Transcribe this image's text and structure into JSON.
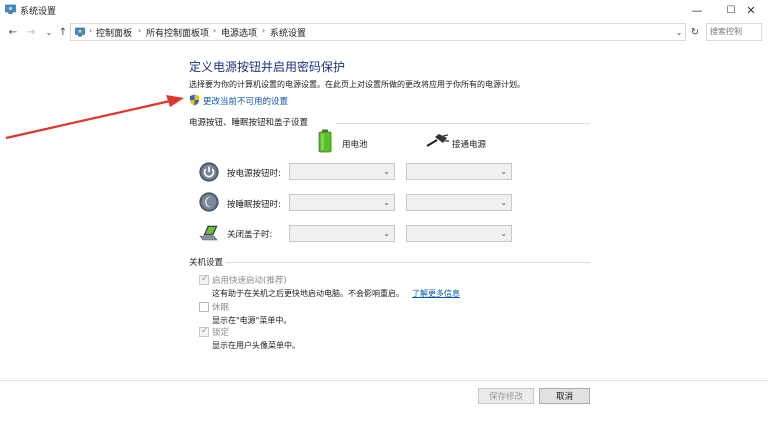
{
  "window": {
    "title": "系统设置",
    "controls": {
      "minimize": "—",
      "maximize": "☐",
      "close": "✕"
    }
  },
  "nav": {
    "back": "←",
    "forward": "→",
    "recent": "⌄",
    "up": "↑"
  },
  "breadcrumbs": [
    "控制面板",
    "所有控制面板项",
    "电源选项",
    "系统设置"
  ],
  "search": {
    "placeholder": "搜索控制"
  },
  "page": {
    "heading": "定义电源按钮并启用密码保护",
    "description": "选择要为你的计算机设置的电源设置。在此页上对设置所做的更改将应用于你所有的电源计划。",
    "change_link": "更改当前不可用的设置"
  },
  "buttons_section": {
    "title": "电源按钮、睡眠按钮和盖子设置",
    "col_battery": "用电池",
    "col_plugged": "接通电源",
    "rows": [
      {
        "label": "按电源按钮时:",
        "icon": "power-button-icon",
        "battery": "",
        "plugged": ""
      },
      {
        "label": "按睡眠按钮时:",
        "icon": "sleep-button-icon",
        "battery": "",
        "plugged": ""
      },
      {
        "label": "关闭盖子时:",
        "icon": "laptop-lid-icon",
        "battery": "",
        "plugged": ""
      }
    ]
  },
  "shutdown_section": {
    "title": "关机设置",
    "options": [
      {
        "label": "启用快速启动(推荐)",
        "desc": "这有助于在关机之后更快地启动电脑。不会影响重启。",
        "link": "了解更多信息",
        "checked": true
      },
      {
        "label": "休眠",
        "desc": "显示在\"电源\"菜单中。",
        "checked": false
      },
      {
        "label": "锁定",
        "desc": "显示在用户头像菜单中。",
        "checked": true
      }
    ]
  },
  "footer": {
    "save": "保存修改",
    "cancel": "取消"
  },
  "colors": {
    "heading": "#1e3287",
    "link": "#0a56b8",
    "annotation_arrow": "#e0352b"
  }
}
